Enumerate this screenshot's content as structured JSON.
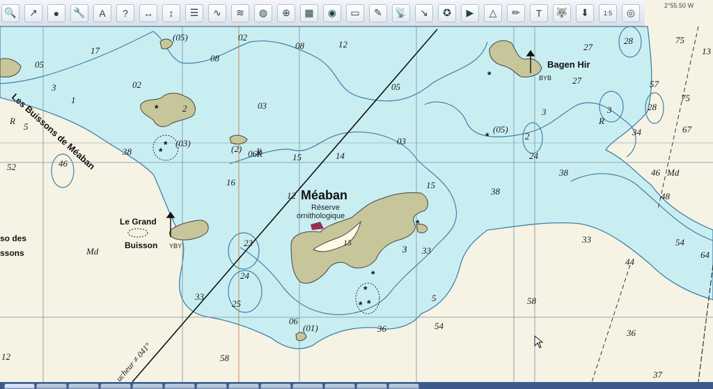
{
  "toolbar": {
    "buttons": [
      {
        "icon": "zoom-icon"
      },
      {
        "icon": "route-icon"
      },
      {
        "icon": "red-marker-icon"
      },
      {
        "icon": "wrench-icon"
      },
      {
        "icon": "text-annotation-icon"
      },
      {
        "icon": "help-cursor-icon"
      },
      {
        "icon": "horizontal-measure-icon"
      },
      {
        "icon": "vertical-measure-icon"
      },
      {
        "icon": "checklist-icon"
      },
      {
        "icon": "tide-curve-icon"
      },
      {
        "icon": "sea-depth-icon"
      },
      {
        "icon": "globe-icon"
      },
      {
        "icon": "crosshair-icon"
      },
      {
        "icon": "chart-tile-icon"
      },
      {
        "icon": "layers-icon"
      },
      {
        "icon": "catalog-icon"
      },
      {
        "icon": "waypoint-edit-icon"
      },
      {
        "icon": "radio-antenna-icon"
      },
      {
        "icon": "arrow-diagonal-icon"
      },
      {
        "icon": "star-badge-icon"
      },
      {
        "icon": "play-flag-icon"
      },
      {
        "icon": "triangle-nav-icon"
      },
      {
        "icon": "pencil-icon"
      },
      {
        "icon": "text-frame-icon"
      },
      {
        "icon": "husky-icon"
      },
      {
        "icon": "download-icon"
      },
      {
        "icon": "zoom-level-icon",
        "label": "1:5"
      },
      {
        "icon": "lifebuoy-icon"
      }
    ]
  },
  "coordinate_readout": "2°55.50 W",
  "map": {
    "place_names": {
      "meaban": "Méaban",
      "reserve": "Réserve",
      "ornithologique": "ornithologique",
      "bagen_hir": "Bagen Hir",
      "byb": "BYB",
      "le_grand": "Le Grand",
      "buisson": "Buisson",
      "yby": "YBY",
      "les_buissons": "Les Buissons de Méaban",
      "so_des": "so des",
      "ssons": "ssons",
      "md_left": "Md",
      "md_right": "Md",
      "bearing": "ucheur ≠ 041°",
      "island_height": "15"
    },
    "soundings": [
      {
        "id": "s1",
        "text": "05"
      },
      {
        "id": "s2",
        "text": "17"
      },
      {
        "id": "s3",
        "text": "(05)"
      },
      {
        "id": "s4",
        "text": "02"
      },
      {
        "id": "s5",
        "text": "08"
      },
      {
        "id": "s6",
        "text": "08"
      },
      {
        "id": "s7",
        "text": "12"
      },
      {
        "id": "s8",
        "text": "1"
      },
      {
        "id": "s9",
        "text": "02"
      },
      {
        "id": "s10",
        "text": "2"
      },
      {
        "id": "s11",
        "text": "03"
      },
      {
        "id": "s12",
        "text": "05"
      },
      {
        "id": "s13",
        "text": "R"
      },
      {
        "id": "s14",
        "text": "38"
      },
      {
        "id": "s15",
        "text": "46"
      },
      {
        "id": "s16",
        "text": "52"
      },
      {
        "id": "s17",
        "text": "(03)"
      },
      {
        "id": "s18",
        "text": "(2)"
      },
      {
        "id": "s19",
        "text": "06R"
      },
      {
        "id": "s20",
        "text": "15"
      },
      {
        "id": "s21",
        "text": "14"
      },
      {
        "id": "s22",
        "text": "03"
      },
      {
        "id": "s23",
        "text": "16"
      },
      {
        "id": "s24",
        "text": "12"
      },
      {
        "id": "s25",
        "text": "15"
      },
      {
        "id": "s26",
        "text": "27"
      },
      {
        "id": "s27",
        "text": "28"
      },
      {
        "id": "s28",
        "text": "27"
      },
      {
        "id": "s29",
        "text": "3"
      },
      {
        "id": "s30",
        "text": "3"
      },
      {
        "id": "s31",
        "text": "R"
      },
      {
        "id": "s32",
        "text": "28"
      },
      {
        "id": "s33",
        "text": "(05)"
      },
      {
        "id": "s34",
        "text": "2"
      },
      {
        "id": "s35",
        "text": "24"
      },
      {
        "id": "s36",
        "text": "38"
      },
      {
        "id": "s37",
        "text": "34"
      },
      {
        "id": "s38",
        "text": "46"
      },
      {
        "id": "s39",
        "text": "48"
      },
      {
        "id": "s40",
        "text": "38"
      },
      {
        "id": "s41",
        "text": "33"
      },
      {
        "id": "s42",
        "text": "44"
      },
      {
        "id": "s43",
        "text": "54"
      },
      {
        "id": "s44",
        "text": "64"
      },
      {
        "id": "s45",
        "text": "23"
      },
      {
        "id": "s46",
        "text": "24"
      },
      {
        "id": "s47",
        "text": "33"
      },
      {
        "id": "s48",
        "text": "25"
      },
      {
        "id": "s49",
        "text": "33"
      },
      {
        "id": "s50",
        "text": "3"
      },
      {
        "id": "s51",
        "text": "06"
      },
      {
        "id": "s52",
        "text": "(01)"
      },
      {
        "id": "s53",
        "text": "36"
      },
      {
        "id": "s54",
        "text": "54"
      },
      {
        "id": "s55",
        "text": "58"
      },
      {
        "id": "s56",
        "text": "58"
      },
      {
        "id": "s57",
        "text": "36"
      },
      {
        "id": "s58",
        "text": "37"
      },
      {
        "id": "s59",
        "text": "75"
      },
      {
        "id": "s60",
        "text": "13"
      },
      {
        "id": "s61",
        "text": "57"
      },
      {
        "id": "s62",
        "text": "75"
      },
      {
        "id": "s63",
        "text": "67"
      },
      {
        "id": "s64",
        "text": "12"
      },
      {
        "id": "s65",
        "text": "R"
      },
      {
        "id": "s66",
        "text": "3"
      },
      {
        "id": "s67",
        "text": "5"
      },
      {
        "id": "s68",
        "text": "5"
      },
      {
        "id": "s69",
        "text": "3"
      }
    ]
  },
  "colors": {
    "shallow_water": "#c9eef2",
    "deep_water": "#f6f3e4",
    "land": "#c7c59a",
    "contour": "#3f7fa8",
    "track_line": "#111111",
    "grid": "#7a8ea0"
  }
}
